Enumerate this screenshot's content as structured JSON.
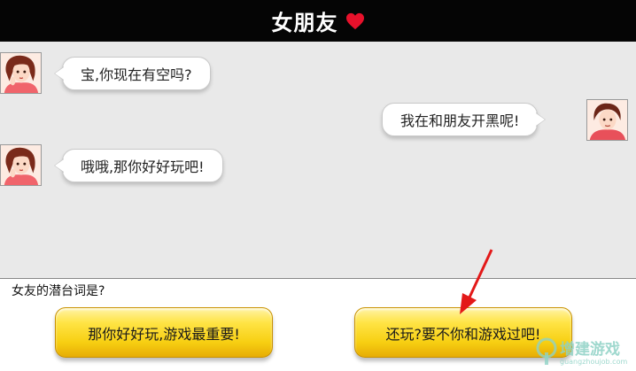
{
  "header": {
    "title": "女朋友",
    "icon": "heart-icon",
    "heart_color": "#e8112b"
  },
  "messages": [
    {
      "sender": "girlfriend",
      "text": "宝,你现在有空吗?"
    },
    {
      "sender": "player",
      "text": "我在和朋友开黑呢!"
    },
    {
      "sender": "girlfriend",
      "text": "哦哦,那你好好玩吧!"
    }
  ],
  "question": "女友的潜台词是?",
  "answers": [
    {
      "label": "那你好好玩,游戏最重要!"
    },
    {
      "label": "还玩?要不你和游戏过吧!"
    }
  ],
  "watermark": {
    "text": "增建游戏",
    "sub": "guangzhoujob.com"
  },
  "colors": {
    "header_bg": "#050505",
    "chat_bg": "#e9e9e9",
    "button_yellow": "#f7cf12",
    "arrow_red": "#e31919"
  }
}
